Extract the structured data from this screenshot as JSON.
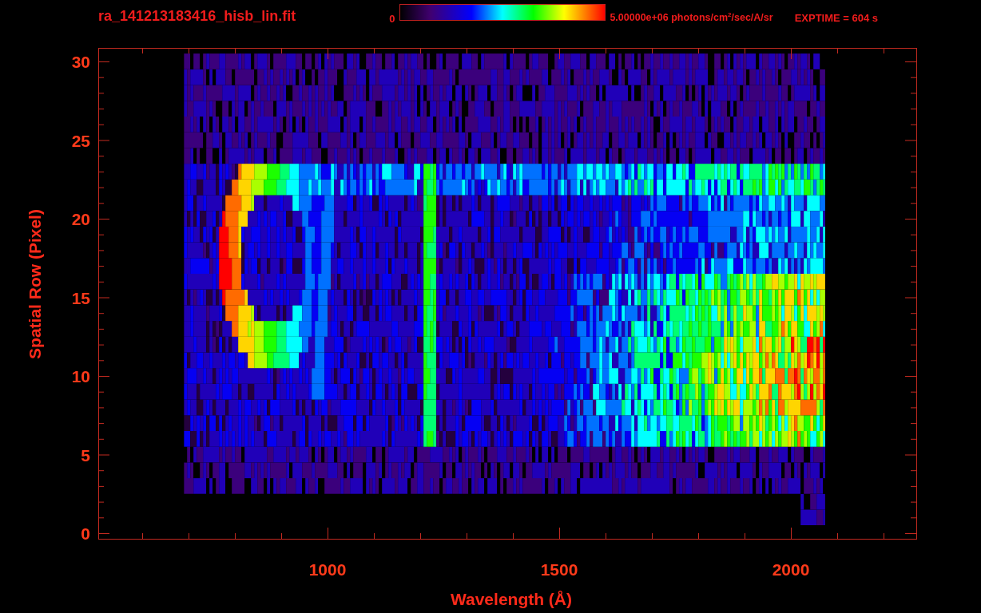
{
  "title": "ra_141213183416_hisb_lin.fit",
  "colorbar": {
    "min_label": "0",
    "max_label": "5.00000e+06 photons/cm$^{2}$/sec/A/sr"
  },
  "exposure": "EXPTIME = 604 s",
  "x_axis": {
    "label": "Wavelength (Å)",
    "ticks": [
      "1000",
      "1500",
      "2000"
    ]
  },
  "y_axis": {
    "label": "Spatial Row (Pixel)",
    "ticks": [
      "30",
      "25",
      "20",
      "15",
      "10",
      "5",
      "0"
    ]
  }
}
